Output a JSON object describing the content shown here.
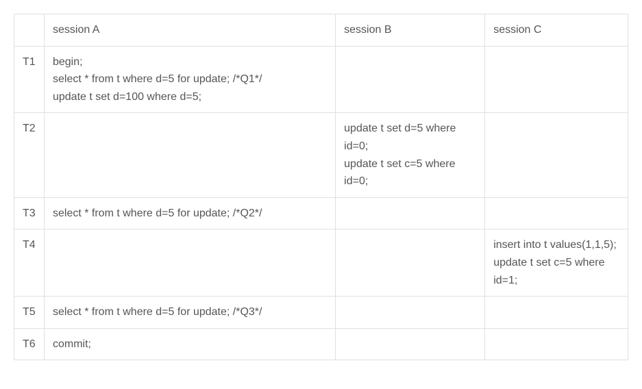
{
  "headers": {
    "time": "",
    "sessionA": "session A",
    "sessionB": "session B",
    "sessionC": "session C"
  },
  "rows": [
    {
      "time": "T1",
      "sessionA": "begin;\nselect * from t where d=5 for update; /*Q1*/\nupdate t set d=100 where d=5;",
      "sessionB": "",
      "sessionC": ""
    },
    {
      "time": "T2",
      "sessionA": "",
      "sessionB": "update t set d=5 where id=0;\nupdate t set c=5 where id=0;",
      "sessionC": ""
    },
    {
      "time": "T3",
      "sessionA": "select * from t where d=5 for update; /*Q2*/",
      "sessionB": "",
      "sessionC": ""
    },
    {
      "time": "T4",
      "sessionA": "",
      "sessionB": "",
      "sessionC": "insert into t values(1,1,5);\nupdate t set c=5 where id=1;"
    },
    {
      "time": "T5",
      "sessionA": "select * from t where d=5 for update; /*Q3*/",
      "sessionB": "",
      "sessionC": ""
    },
    {
      "time": "T6",
      "sessionA": "commit;",
      "sessionB": "",
      "sessionC": ""
    }
  ]
}
